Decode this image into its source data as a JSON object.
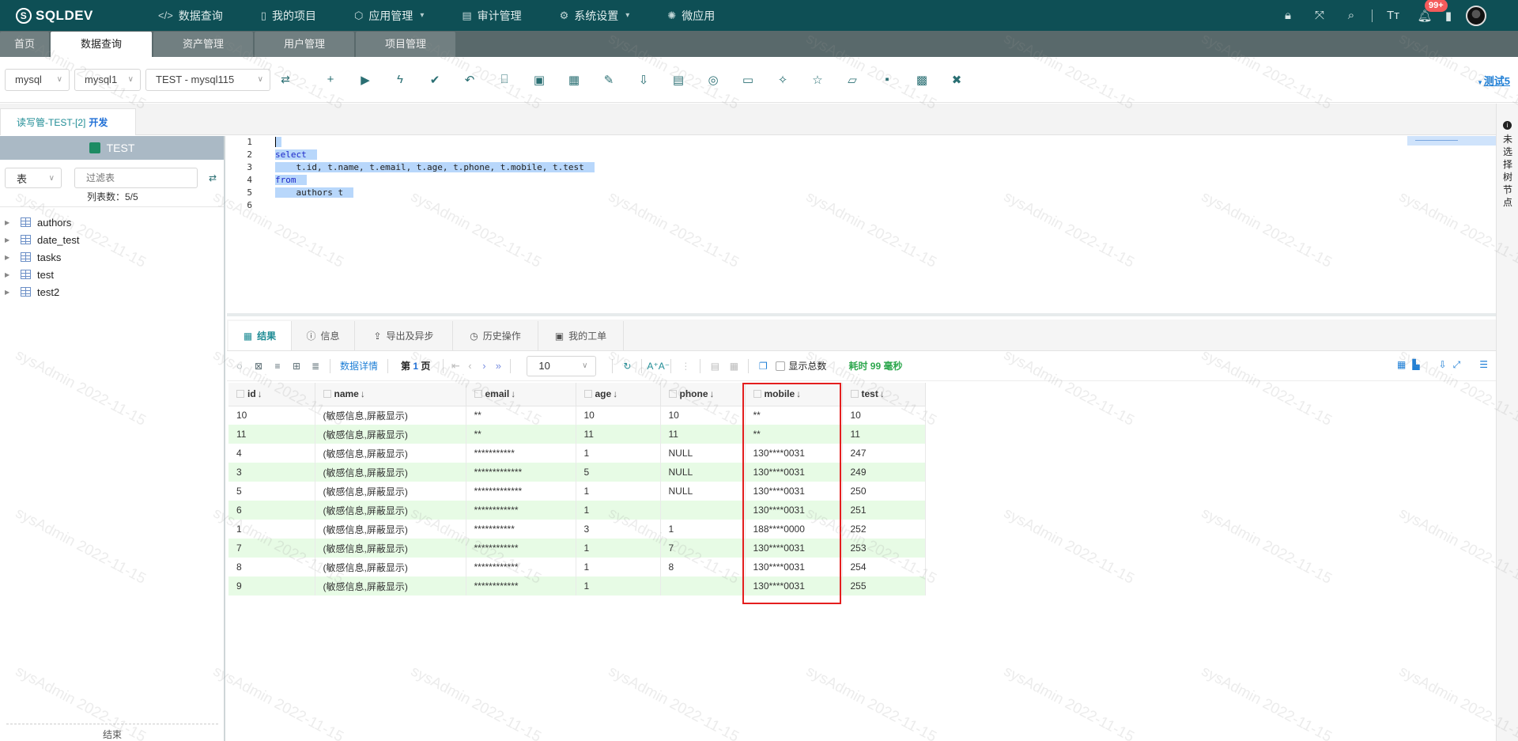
{
  "app": {
    "logo": "SQLDEV",
    "nav": [
      {
        "label": "数据查询",
        "icon": "code-icon"
      },
      {
        "label": "我的项目",
        "icon": "project-icon"
      },
      {
        "label": "应用管理",
        "icon": "app-icon"
      },
      {
        "label": "审计管理",
        "icon": "audit-icon"
      },
      {
        "label": "系统设置",
        "icon": "gear-icon"
      },
      {
        "label": "微应用",
        "icon": "micro-app-icon"
      }
    ],
    "notification_count": "99+"
  },
  "page_tabs": [
    "首页",
    "数据查询",
    "资产管理",
    "用户管理",
    "项目管理"
  ],
  "toolbar": {
    "db_type": "mysql",
    "db_instance": "mysql1",
    "connection": "TEST - mysql115",
    "user": "测试5"
  },
  "conn_tab": {
    "label": "读写管-TEST-[2]",
    "env": "开发"
  },
  "left": {
    "db_name": "TEST",
    "object_type": "表",
    "filter_placeholder": "过滤表",
    "count_label": "列表数：5/5",
    "tables": [
      "authors",
      "date_test",
      "tasks",
      "test",
      "test2"
    ],
    "footer": "结束"
  },
  "editor": {
    "lines": [
      {
        "n": "1",
        "text": ""
      },
      {
        "n": "2",
        "text": "select"
      },
      {
        "n": "3",
        "text": "    t.id, t.name, t.email, t.age, t.phone, t.mobile, t.test"
      },
      {
        "n": "4",
        "text": "from"
      },
      {
        "n": "5",
        "text": "    authors t"
      },
      {
        "n": "6",
        "text": ""
      }
    ]
  },
  "result_tabs": [
    {
      "label": "结果",
      "icon": "grid-icon"
    },
    {
      "label": "信息",
      "icon": "info-icon"
    },
    {
      "label": "导出及异步",
      "icon": "export-icon"
    },
    {
      "label": "历史操作",
      "icon": "history-icon"
    },
    {
      "label": "我的工单",
      "icon": "ticket-icon"
    }
  ],
  "result_toolbar": {
    "data_detail": "数据详情",
    "page_prefix": "第",
    "page_num": "1",
    "page_suffix": "页",
    "page_size": "10",
    "show_total": "显示总数",
    "elapsed": "耗时 99 毫秒"
  },
  "grid": {
    "columns": [
      "id",
      "name",
      "email",
      "age",
      "phone",
      "mobile",
      "test"
    ],
    "rows": [
      [
        "10",
        "(敏感信息,屏蔽显示)",
        "**",
        "10",
        "10",
        "**",
        "10"
      ],
      [
        "11",
        "(敏感信息,屏蔽显示)",
        "**",
        "11",
        "11",
        "**",
        "11"
      ],
      [
        "4",
        "(敏感信息,屏蔽显示)",
        "***********",
        "1",
        "NULL",
        "130****0031",
        "247"
      ],
      [
        "3",
        "(敏感信息,屏蔽显示)",
        "*************",
        "5",
        "NULL",
        "130****0031",
        "249"
      ],
      [
        "5",
        "(敏感信息,屏蔽显示)",
        "*************",
        "1",
        "NULL",
        "130****0031",
        "250"
      ],
      [
        "6",
        "(敏感信息,屏蔽显示)",
        "************",
        "1",
        "",
        "130****0031",
        "251"
      ],
      [
        "1",
        "(敏感信息,屏蔽显示)",
        "***********",
        "3",
        "1",
        "188****0000",
        "252"
      ],
      [
        "7",
        "(敏感信息,屏蔽显示)",
        "************",
        "1",
        "7",
        "130****0031",
        "253"
      ],
      [
        "8",
        "(敏感信息,屏蔽显示)",
        "************",
        "1",
        "8",
        "130****0031",
        "254"
      ],
      [
        "9",
        "(敏感信息,屏蔽显示)",
        "************",
        "1",
        "",
        "130****0031",
        "255"
      ]
    ]
  },
  "right_panel": {
    "text": "未选择树节点"
  },
  "watermark": "sysAdmin 2022-11-15"
}
